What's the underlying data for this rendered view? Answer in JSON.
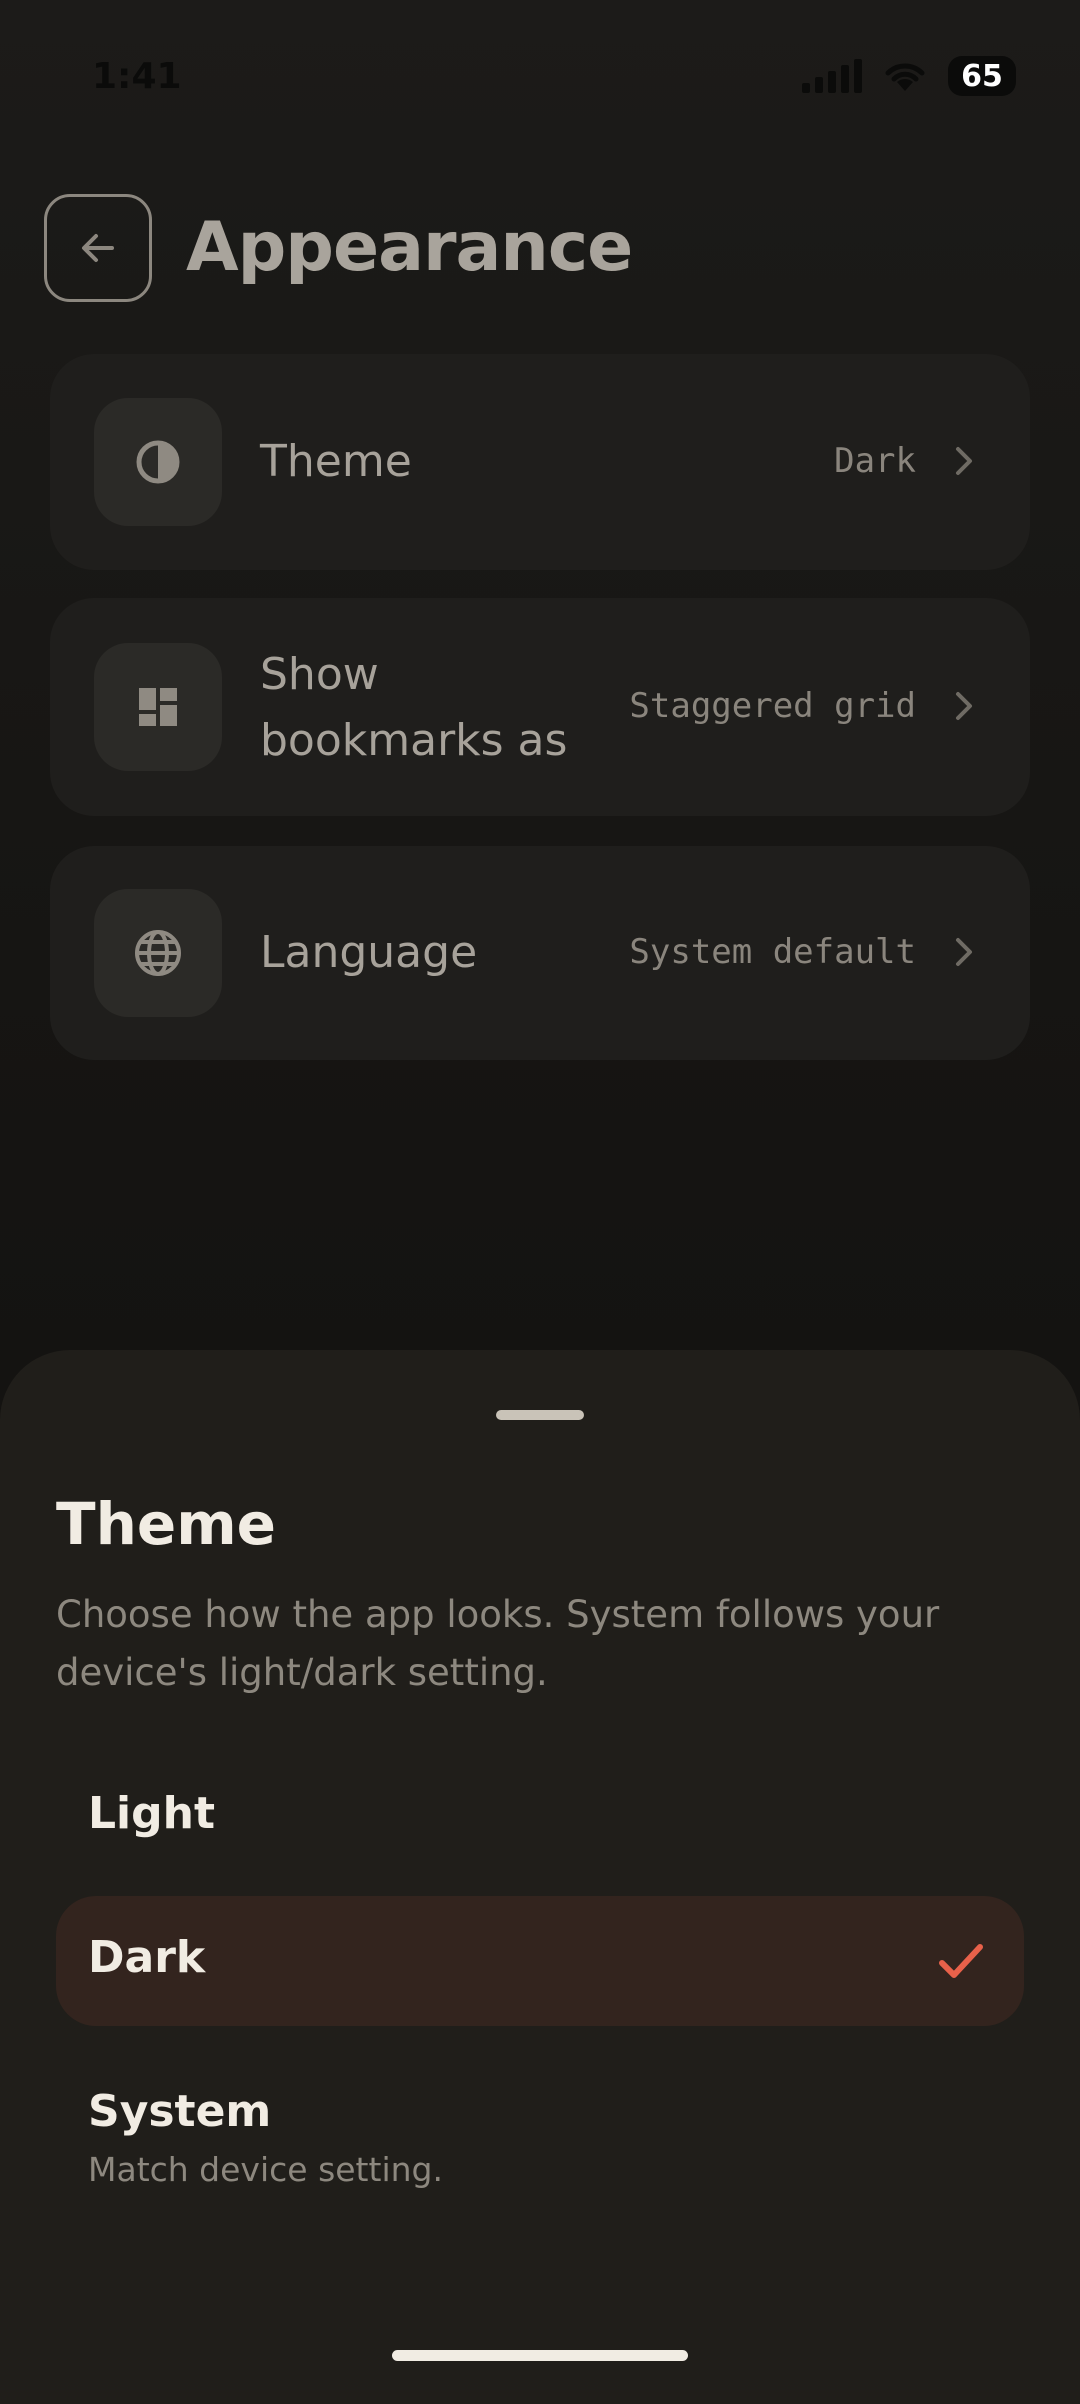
{
  "status_bar": {
    "time": "1:41",
    "battery": "65"
  },
  "header": {
    "title": "Appearance"
  },
  "settings": [
    {
      "label": "Theme",
      "value": "Dark",
      "icon": "contrast-icon"
    },
    {
      "label": "Show bookmarks as",
      "value": "Staggered grid",
      "icon": "grid-icon"
    },
    {
      "label": "Language",
      "value": "System default",
      "icon": "globe-icon"
    }
  ],
  "sheet": {
    "title": "Theme",
    "description": "Choose how the app looks. System follows your device's light/dark setting.",
    "options": [
      {
        "label": "Light",
        "subtitle": "",
        "selected": false
      },
      {
        "label": "Dark",
        "subtitle": "",
        "selected": true
      },
      {
        "label": "System",
        "subtitle": "Match device setting.",
        "selected": false
      }
    ]
  },
  "colors": {
    "accent": "#e8614a",
    "selected_bg": "#33241e",
    "sheet_bg": "#201e1a"
  }
}
